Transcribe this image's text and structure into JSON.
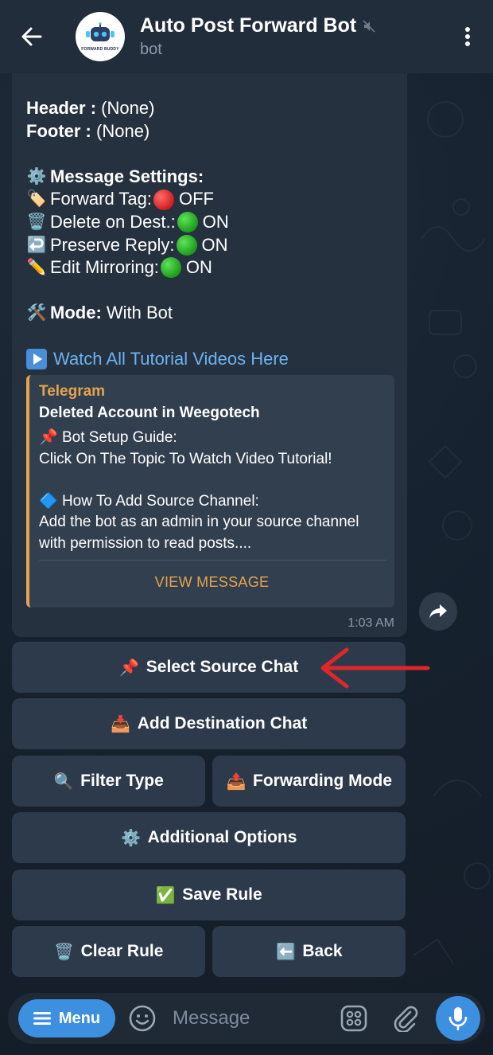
{
  "header": {
    "title": "Auto Post Forward Bot",
    "subtitle": "bot",
    "avatar_text": "FORWARD BUDDY",
    "muted": true
  },
  "message": {
    "header_label": "Header :",
    "header_value": "(None)",
    "footer_label": "Footer :",
    "footer_value": "(None)",
    "settings_title": "Message Settings:",
    "forward_tag_label": "Forward Tag:",
    "forward_tag_value": "OFF",
    "delete_label": "Delete on Dest.:",
    "delete_value": "ON",
    "reply_label": "Preserve Reply:",
    "reply_value": "ON",
    "edit_label": "Edit Mirroring:",
    "edit_value": "ON",
    "mode_label": "Mode:",
    "mode_value": "With Bot",
    "tutorial_link": "Watch All Tutorial Videos Here",
    "time": "1:03 AM"
  },
  "preview": {
    "site": "Telegram",
    "title": "Deleted Account in Weegotech",
    "line1": "Bot Setup Guide:",
    "line2": "Click On The Topic To Watch Video Tutorial!",
    "line3": "How To Add Source Channel:",
    "line4": "Add the bot as an admin in your source channel",
    "line5": "with permission to read posts....",
    "action": "VIEW MESSAGE"
  },
  "keyboard": {
    "select_source": "Select Source Chat",
    "add_destination": "Add Destination Chat",
    "filter_type": "Filter Type",
    "forwarding_mode": "Forwarding Mode",
    "additional_options": "Additional Options",
    "save_rule": "Save Rule",
    "clear_rule": "Clear Rule",
    "back": "Back"
  },
  "input_bar": {
    "menu_label": "Menu",
    "placeholder": "Message"
  },
  "colors": {
    "accent": "#3d8fe0",
    "link": "#6cb2f2",
    "preview_accent": "#e6a34f",
    "annotation_arrow": "#e0262a"
  }
}
